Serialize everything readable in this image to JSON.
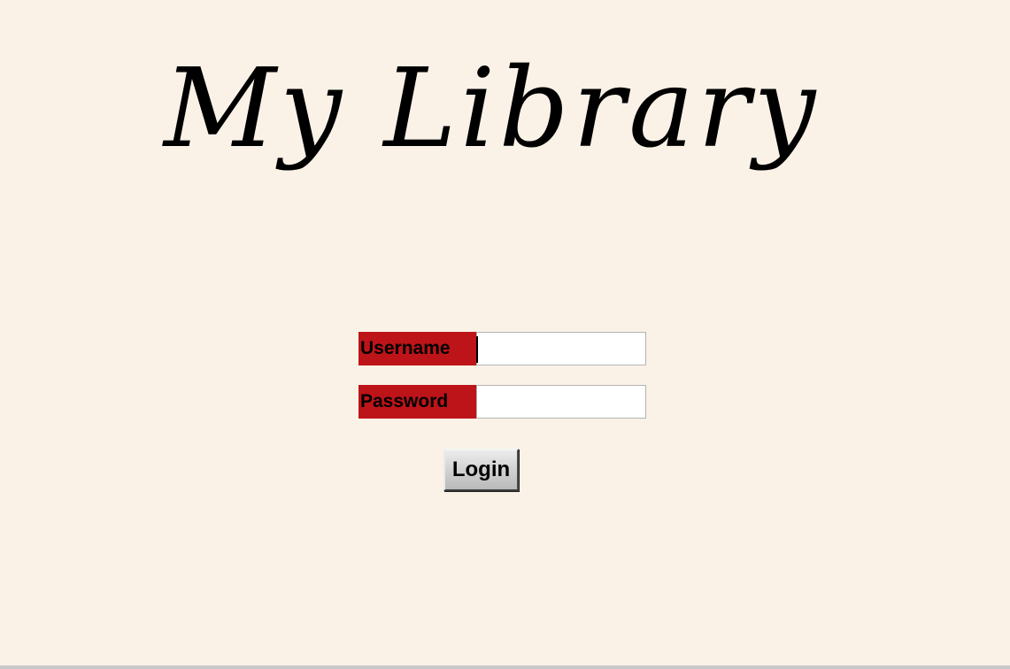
{
  "app": {
    "title": "My Library"
  },
  "login_form": {
    "username_label": "Username",
    "username_value": "",
    "password_label": "Password",
    "password_value": "",
    "login_button_label": "Login"
  },
  "colors": {
    "background": "#faf2e7",
    "label_background": "#bd1419",
    "input_background": "#ffffff",
    "button_face": "#d2d2d2"
  }
}
